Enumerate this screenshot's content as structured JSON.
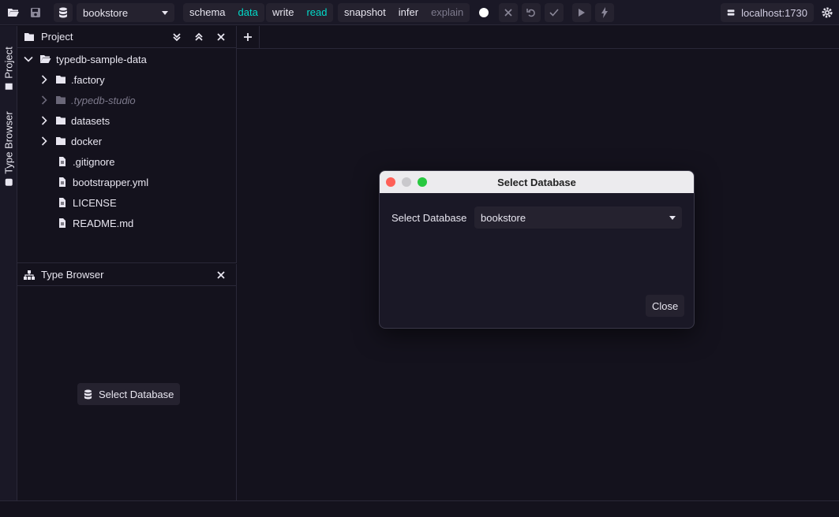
{
  "toolbar": {
    "database": "bookstore",
    "session_schema": "schema",
    "session_data": "data",
    "tx_write": "write",
    "tx_read": "read",
    "opt_snapshot": "snapshot",
    "opt_infer": "infer",
    "opt_explain": "explain",
    "server": "localhost:1730"
  },
  "sidebar_tabs": {
    "project": "Project",
    "type_browser": "Type Browser"
  },
  "project_panel": {
    "title": "Project",
    "root": "typedb-sample-data",
    "items": [
      {
        "label": ".factory",
        "type": "folder"
      },
      {
        "label": ".typedb-studio",
        "type": "folder-muted"
      },
      {
        "label": "datasets",
        "type": "folder"
      },
      {
        "label": "docker",
        "type": "folder"
      },
      {
        "label": ".gitignore",
        "type": "file"
      },
      {
        "label": "bootstrapper.yml",
        "type": "file"
      },
      {
        "label": "LICENSE",
        "type": "file"
      },
      {
        "label": "README.md",
        "type": "file"
      }
    ]
  },
  "type_browser": {
    "title": "Type Browser",
    "select_db_button": "Select Database"
  },
  "dialog": {
    "title": "Select Database",
    "field_label": "Select Database",
    "selected_db": "bookstore",
    "close_button": "Close"
  },
  "colors": {
    "accent": "#02dac9",
    "background": "#14121d",
    "surface": "#25222f"
  }
}
